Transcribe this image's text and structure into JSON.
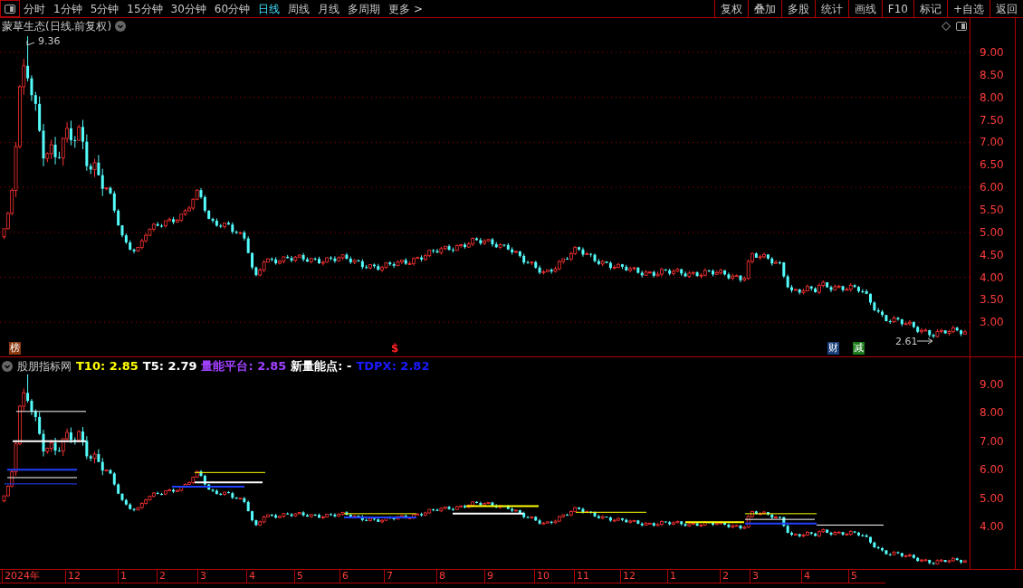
{
  "toolbar": {
    "periods": [
      {
        "label": "分时",
        "selected": false
      },
      {
        "label": "1分钟",
        "selected": false
      },
      {
        "label": "5分钟",
        "selected": false
      },
      {
        "label": "15分钟",
        "selected": false
      },
      {
        "label": "30分钟",
        "selected": false
      },
      {
        "label": "60分钟",
        "selected": false
      },
      {
        "label": "日线",
        "selected": true
      },
      {
        "label": "周线",
        "selected": false
      },
      {
        "label": "月线",
        "selected": false
      },
      {
        "label": "多周期",
        "selected": false
      }
    ],
    "more": "更多 >",
    "buttons": [
      "复权",
      "叠加",
      "多股",
      "统计",
      "画线",
      "F10",
      "标记",
      "+自选",
      "返回"
    ]
  },
  "main_pane": {
    "title": "蒙草生态(日线.前复权)",
    "high_label": "9.36",
    "low_label": "2.61",
    "y_ticks": [
      "9.00",
      "8.50",
      "8.00",
      "7.50",
      "7.00",
      "6.50",
      "6.00",
      "5.50",
      "5.00",
      "4.50",
      "4.00",
      "3.50",
      "3.00"
    ],
    "event_markers": [
      {
        "kind": "badge",
        "text": "榜",
        "color": "#8b3a10"
      },
      {
        "kind": "glyph",
        "text": "$",
        "color": "#ff2020"
      },
      {
        "kind": "badge",
        "text": "财",
        "color": "#1a3f7a"
      },
      {
        "kind": "badge",
        "text": "减",
        "color": "#1a7a1a"
      }
    ]
  },
  "indicator_pane": {
    "name": "股朋指标网",
    "values": [
      {
        "text": "T10: 2.85",
        "color": "#ffff00"
      },
      {
        "text": "T5: 2.79",
        "color": "#ffffff"
      },
      {
        "text": "量能平台: 2.85",
        "color": "#a040ff"
      },
      {
        "text": "新量能点: -",
        "color": "#ffffff"
      },
      {
        "text": "TDPX: 2.82",
        "color": "#1a1aff"
      }
    ],
    "y_ticks": [
      "9.00",
      "8.00",
      "7.00",
      "6.00",
      "5.00",
      "4.00"
    ]
  },
  "x_axis": {
    "labels": [
      "2024年",
      "12",
      "1",
      "2",
      "3",
      "4",
      "5",
      "6",
      "7",
      "8",
      "9",
      "10",
      "11",
      "12",
      "1",
      "2",
      "3",
      "4",
      "5"
    ]
  }
}
